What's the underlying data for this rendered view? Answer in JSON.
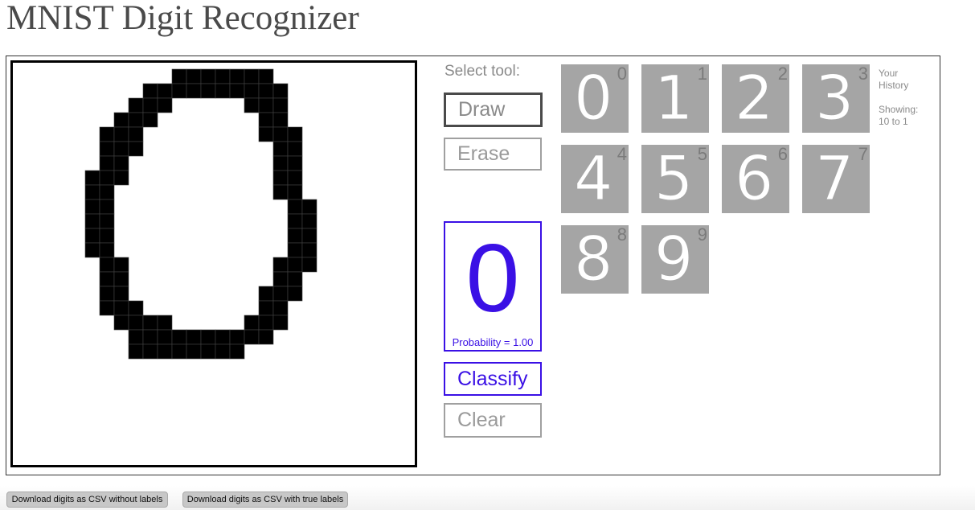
{
  "page": {
    "title": "MNIST Digit Recognizer"
  },
  "tools": {
    "heading": "Select tool:",
    "draw_label": "Draw",
    "erase_label": "Erase",
    "classify_label": "Classify",
    "clear_label": "Clear",
    "active_tool": "Draw"
  },
  "prediction": {
    "digit": "0",
    "probability_label": "Probability = 1.00"
  },
  "history": {
    "caption_line1": "Your",
    "caption_line2": "History",
    "showing_label": "Showing:",
    "showing_range": "10 to 1",
    "items": [
      {
        "label": "0",
        "glyph": "0"
      },
      {
        "label": "1",
        "glyph": "1"
      },
      {
        "label": "2",
        "glyph": "2"
      },
      {
        "label": "3",
        "glyph": "3"
      },
      {
        "label": "4",
        "glyph": "4"
      },
      {
        "label": "5",
        "glyph": "5"
      },
      {
        "label": "6",
        "glyph": "6"
      },
      {
        "label": "7",
        "glyph": "7"
      },
      {
        "label": "8",
        "glyph": "8"
      },
      {
        "label": "9",
        "glyph": "9"
      }
    ]
  },
  "downloads": {
    "without_labels": "Download digits as CSV without labels",
    "with_true_labels": "Download digits as CSV with true labels"
  },
  "colors": {
    "accent": "#3a10e5",
    "tile_bg": "#a5a5a5",
    "tile_text": "#7b7b7b"
  },
  "canvas": {
    "grid_cells": 28,
    "drawn_digit": "0"
  }
}
